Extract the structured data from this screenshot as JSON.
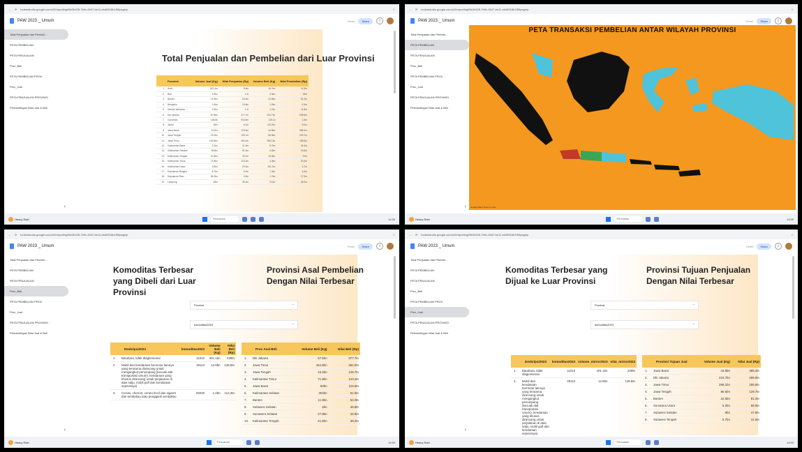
{
  "browser": {
    "url": "lookerstudio.google.com/u/0/reporting/f6e2b428-7b0c-4547-be11-ebd8918b1f5f/page/p"
  },
  "app": {
    "title": "PAW 2023 _ Umum",
    "reset": "Reset",
    "share": "Share"
  },
  "nav": [
    "Total Penjualan dan Pembel...",
    "PETA PEMBELIAN",
    "PETA PENJUALAN",
    "Prov_Beli",
    "PETA PEMBELIAN PROV",
    "Prov_Jual",
    "PETA PENJUALAN PROVINSI",
    "Perbandingan Nilai Jual & Beli"
  ],
  "taskbar": {
    "weather": "Heavy Rain",
    "weather_sub": "Next hr",
    "search": "Pencarian",
    "time": "14:59",
    "date": "30/05/2024"
  },
  "q1": {
    "title": "Total Penjualan dan Pembelian dari Luar Provinsi",
    "headers": [
      "Provinsi",
      "Volume Jual (Kg)",
      "Nilai Penjualan (Rp)",
      "Volume Beli (Kg)",
      "Nilai Pembelian (Rp)"
    ],
    "rows": [
      [
        "1.",
        "Aceh",
        "321.4m",
        "9.8m",
        "16.7bn",
        "14.5m"
      ],
      [
        "2.",
        "Bali",
        "1.9bn",
        "4.1t",
        "3.3bn",
        "23m"
      ],
      [
        "3.",
        "Banten",
        "11.9bn",
        "54.0m",
        "22.5bn",
        "81.2m"
      ],
      [
        "4.",
        "Bengkulu",
        "2.4bn",
        "15.6m",
        "1.2bn",
        "4.9m"
      ],
      [
        "5.",
        "Daerah Istimewa ...",
        "1.9bn",
        "4.1t",
        "1.7bn",
        "11.5m"
      ],
      [
        "6.",
        "Dki Jakarta",
        "57.6bn",
        "377.7m",
        "224.7bn",
        "289.5m"
      ],
      [
        "7.",
        "Gorontalo",
        "158.8k",
        "915.8m",
        "118.1k",
        "1.5m"
      ],
      [
        "8.",
        "Jambi",
        "18m",
        "5.2m",
        "322.5m",
        "5.2m"
      ],
      [
        "9.",
        "Jawa Barat",
        "44.8m",
        "119.5m",
        "44.8bn",
        "385.4m"
      ],
      [
        "10.",
        "Jawa Tengah",
        "15.2bn",
        "128.7m",
        "86.5bn",
        "129.7m"
      ],
      [
        "11.",
        "Jawa Timur",
        "184.8bn",
        "364.0m",
        "268.1bn",
        "155.6m"
      ],
      [
        "12.",
        "Kalimantan Barat",
        "2.2bn",
        "21.9m",
        "6.7bn",
        "24.4m"
      ],
      [
        "13.",
        "Kalimantan Selatan",
        "304bn",
        "61.5m",
        "4.5bn",
        "13.6m"
      ],
      [
        "14.",
        "Kalimantan Tengah",
        "21.5bn",
        "39.2m",
        "13.5bn",
        "37m"
      ],
      [
        "15.",
        "Kalimantan Timur",
        "71.8bn",
        "123.2m",
        "4.3bn",
        "20.4m"
      ],
      [
        "16.",
        "Kalimantan Utara",
        "3.3bn",
        "23.4m",
        "151.3m",
        "4.7m"
      ],
      [
        "17.",
        "Kepulauan Bangka...",
        "5.7bn",
        "5.4m",
        "1.3bn",
        "4.6m"
      ],
      [
        "18.",
        "Kepulauan Riau",
        "56.2bn",
        "2.9m",
        "1.7bn",
        "17.2m"
      ],
      [
        "19.",
        "Lampung",
        "28m",
        "35.4m",
        "3.1bn",
        "45.2m"
      ]
    ]
  },
  "q2": {
    "title": "PETA TRANSAKSI PEMBELIAN ANTAR WILAYAH PROVINSI",
    "footer": "Google Maps Terms of Use"
  },
  "q3": {
    "title_left": "Komoditas Terbesar yang Dibeli dari Luar Provinsi",
    "title_right": "Provinsi Asal Pembelian Dengan Nilai Terbesar",
    "dd1": "Provinsi",
    "dd2": "komoditas2023",
    "t1_headers": [
      "Deskripsi2023",
      "komoditas2023",
      "Volume Beli (Kg)",
      "Nilai Beli (Rp)"
    ],
    "t1_rows": [
      [
        "1.",
        "Batubara, tidak diaglomerasi",
        "11010",
        "401.1bn",
        "229tn"
      ],
      [
        "2.",
        "Mobil dan kendaraan bermotor lainnya yang terutama dirancang untuk mengangkut penumpang (kecuali alat transportasi umum), kendaraan yang khusus dirancang untuk perjalanan di atas salju, mobil golf dan kendaraan sejenisnya)",
        "49113",
        "12.8bn",
        "149.6tn"
      ],
      [
        "3.",
        "Cerutu, cheroot, cerutu kecil dan sigaret dari tembakau atau pengganti tembakau",
        "25020",
        "1.2bn",
        "114.3tn"
      ]
    ],
    "t2_headers": [
      "Prov Asal Beli",
      "Volume Beli (Kg)",
      "Nilai Beli (Rp)"
    ],
    "t2_rows": [
      [
        "1.",
        "Dki Jakarta",
        "57.6bn",
        "377.7tn"
      ],
      [
        "2.",
        "Jawa Timur",
        "184.8bn",
        "364.0tn"
      ],
      [
        "3.",
        "Jawa Tengah",
        "15.2bn",
        "128.7tn"
      ],
      [
        "4.",
        "Kalimantan Timur",
        "71.8bn",
        "123.2tn"
      ],
      [
        "5.",
        "Jawa Barat",
        "60bn",
        "119.5tn"
      ],
      [
        "6.",
        "Kalimantan Selatan",
        "304bn",
        "61.5tn"
      ],
      [
        "7.",
        "Banten",
        "11.9bn",
        "54.0tn"
      ],
      [
        "8.",
        "Sulawesi Selatan",
        "4bn",
        "46.8tn"
      ],
      [
        "9.",
        "Sumatera Selatan",
        "27.8bn",
        "42.8tn"
      ],
      [
        "10.",
        "Kalimantan Tengah",
        "21.5bn",
        "39.2tn"
      ]
    ]
  },
  "q4": {
    "title_left": "Komoditas Terbesar yang Dijual ke Luar Provinsi",
    "title_right": "Provinsi Tujuan Penjualan Dengan Nilai Terbesar",
    "dd1": "Provinsi",
    "dd2": "komoditas2023",
    "t1_headers": [
      "Deskripsi2023",
      "komoditas2023",
      "volume_mirror2023",
      "nilai_mirror2023"
    ],
    "t1_rows": [
      [
        "1.",
        "Batubara, tidak diaglomerasi",
        "11010",
        "401.1bn",
        "229tn"
      ],
      [
        "2.",
        "Mobil dan kendaraan bermotor lainnya yang terutama dirancang untuk mengangkut penumpang (kecuali alat transportasi umum), kendaraan yang khusus dirancang untuk perjalanan di atas salju, mobil golf dan kendaraan sejenisnya)",
        "49113",
        "12.8bn",
        "149.6tn"
      ]
    ],
    "t2_headers": [
      "Provinsi Tujuan Jual",
      "Volume Jual (Kg)",
      "Nilai Jual (Rp)"
    ],
    "t2_rows": [
      [
        "1.",
        "Jawa Barat",
        "44.8bn",
        "385.4tn"
      ],
      [
        "2.",
        "Dki Jakarta",
        "224.7bn",
        "289.5tn"
      ],
      [
        "3.",
        "Jawa Timur",
        "268.1bn",
        "155.6tn"
      ],
      [
        "4.",
        "Jawa Tengah",
        "86.5bn",
        "129.7tn"
      ],
      [
        "5.",
        "Banten",
        "22.5bn",
        "81.2tn"
      ],
      [
        "6.",
        "Sumatera Utara",
        "6.2bn",
        "58.9tn"
      ],
      [
        "7.",
        "Sulawesi Selatan",
        "9bn",
        "47.6tn"
      ],
      [
        "8.",
        "Sulawesi Tengah",
        "5.7bn",
        "41.6tn"
      ]
    ]
  },
  "colors": {
    "accent": "#f7c75c",
    "map_bg": "#f49820",
    "land_black": "#111111",
    "land_cyan": "#4fc3d9",
    "red": "#c0392b",
    "green": "#3aa655"
  }
}
